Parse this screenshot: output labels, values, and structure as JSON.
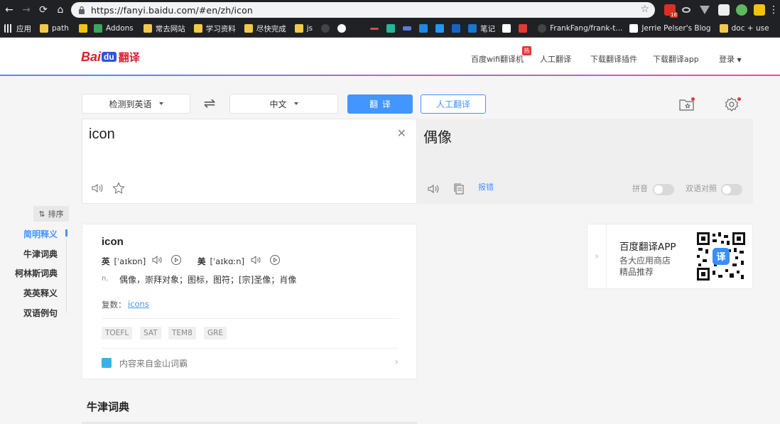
{
  "browser": {
    "url": "https://fanyi.baidu.com/#en/zh/icon",
    "gmail_badge": "16",
    "bookmarks": [
      "应用",
      "path",
      "Addons",
      "常去网站",
      "学习资料",
      "尽快完成",
      "js",
      "笔记",
      "FrankFang/frank-t...",
      "Jerrie Pelser's Blog",
      "doc + use"
    ]
  },
  "header": {
    "logo_bai": "Bai",
    "logo_du": "du",
    "logo_fanyi": "翻译",
    "nav": [
      "百度wifi翻译机",
      "人工翻译",
      "下载翻译插件",
      "下载翻译app",
      "登录"
    ],
    "hot_badge": "热"
  },
  "controls": {
    "source_lang": "检测到英语",
    "target_lang": "中文",
    "translate_btn": "翻译",
    "human_btn": "人工翻译"
  },
  "translation": {
    "source_text": "icon",
    "target_text": "偶像",
    "report_link": "报错",
    "pinyin_label": "拼音",
    "bilingual_label": "双语对照"
  },
  "sidenav": {
    "sort_label": "排序",
    "items": [
      "简明释义",
      "牛津词典",
      "柯林斯词典",
      "英英释义",
      "双语例句"
    ]
  },
  "dictionary": {
    "word": "icon",
    "uk_label": "英",
    "uk_phonetic": "[ˈaɪkɒn]",
    "us_label": "美",
    "us_phonetic": "[ˈaɪkɑːn]",
    "pos": "n.",
    "definition": "偶像，崇拜对象；图标，图符；[宗]圣像；肖像",
    "plural_label": "复数：",
    "plural_value": "icons",
    "tags": [
      "TOEFL",
      "SAT",
      "TEM8",
      "GRE"
    ],
    "source_label": "内容来自金山词霸"
  },
  "ad": {
    "title": "百度翻译APP",
    "line1": "各大应用商店",
    "line2": "精品推荐"
  },
  "section_title": "牛津词典"
}
